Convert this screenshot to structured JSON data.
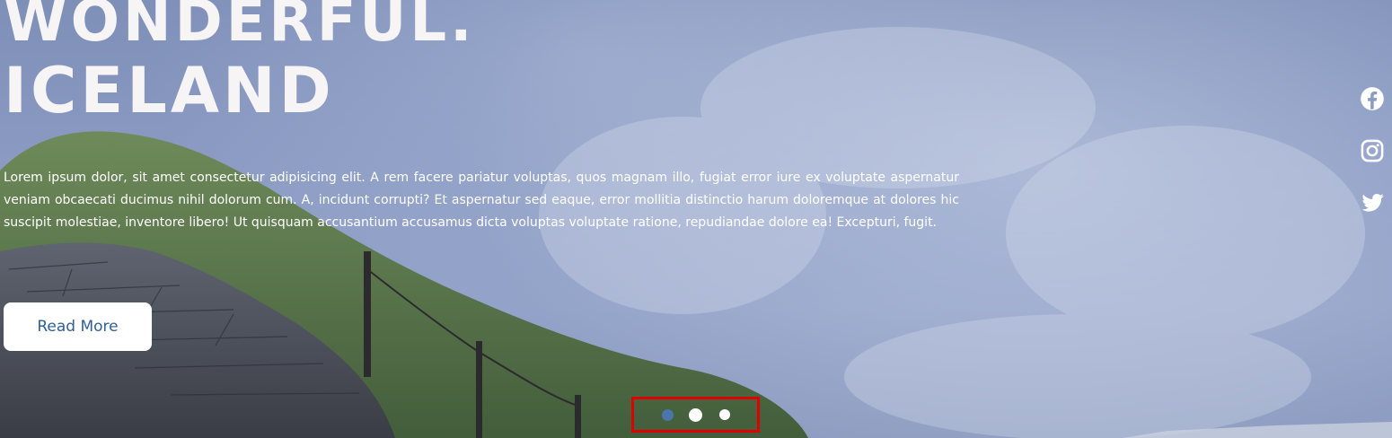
{
  "hero": {
    "title_line_1": "WONDERFUL.",
    "title_line_2": "ICELAND",
    "description": "Lorem ipsum dolor, sit amet consectetur adipisicing elit. A rem facere pariatur voluptas, quos magnam illo, fugiat error iure ex voluptate aspernatur veniam obcaecati ducimus nihil dolorum cum. A, incidunt corrupti? Et aspernatur sed eaque, error mollitia distinctio harum doloremque at dolores hic suscipit molestiae, inventore libero! Ut quisquam accusantium accusamus dicta voluptas voluptate ratione, repudiandae dolore ea! Excepturi, fugit.",
    "button_label": "Read More"
  },
  "social": [
    {
      "icon": "facebook-icon"
    },
    {
      "icon": "instagram-icon"
    },
    {
      "icon": "twitter-icon"
    }
  ],
  "slider": {
    "active_index": 1,
    "dot_count": 3
  },
  "colors": {
    "title": "#f7f4f6",
    "button_text": "#2f5f97",
    "active_dot": "#4b76ab",
    "inactive_dot": "#ffffff",
    "highlight_border": "#e00000"
  }
}
